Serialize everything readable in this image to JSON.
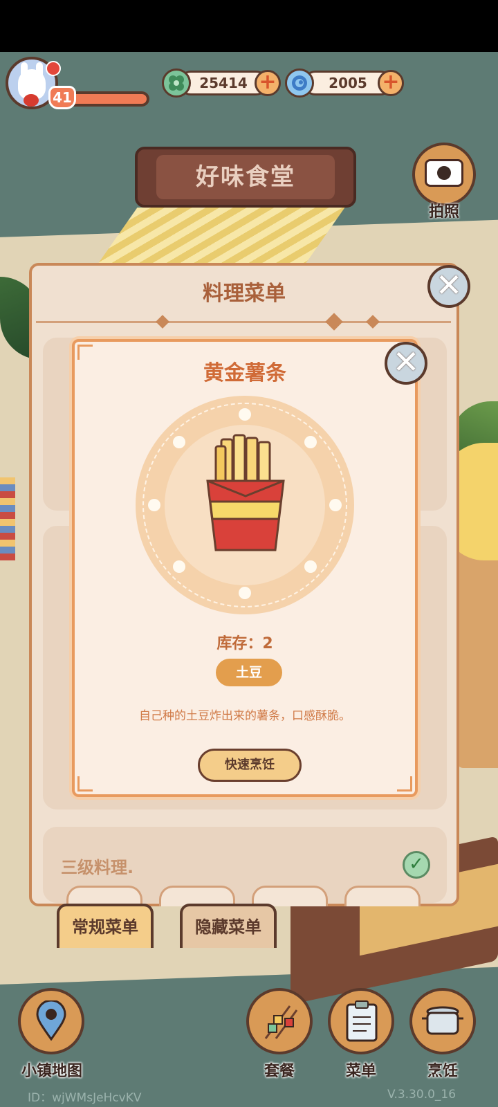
{
  "hud": {
    "level": "41",
    "coins": "25414",
    "gems": "2005",
    "plus": "+"
  },
  "restaurant": {
    "sign": "好味食堂",
    "camera_label": "拍照"
  },
  "menu_panel": {
    "title": "料理菜单",
    "section_three_label": "三级料理.",
    "tabs": [
      "常规菜单",
      "隐藏菜单"
    ]
  },
  "dish_popup": {
    "title": "黄金薯条",
    "stock_label": "库存：2",
    "ingredient": "土豆",
    "description": "自己种的土豆炸出来的薯条，口感酥脆。",
    "cook_button": "快速烹饪"
  },
  "bottom_nav": {
    "map": "小镇地图",
    "set_meal": "套餐",
    "menu": "菜单",
    "cook": "烹饪"
  },
  "footer": {
    "id": "ID：wjWMsJeHcvKV",
    "version": "V.3.30.0_16"
  },
  "icons": {
    "close": "close-icon",
    "check": "check-icon",
    "map_pin": "map-pin-icon",
    "camera": "camera-icon",
    "coin": "clover-coin-icon",
    "gem": "swirl-gem-icon"
  },
  "colors": {
    "accent": "#d06b37",
    "panel": "#f0e0d0",
    "button": "#f4cd8a"
  }
}
